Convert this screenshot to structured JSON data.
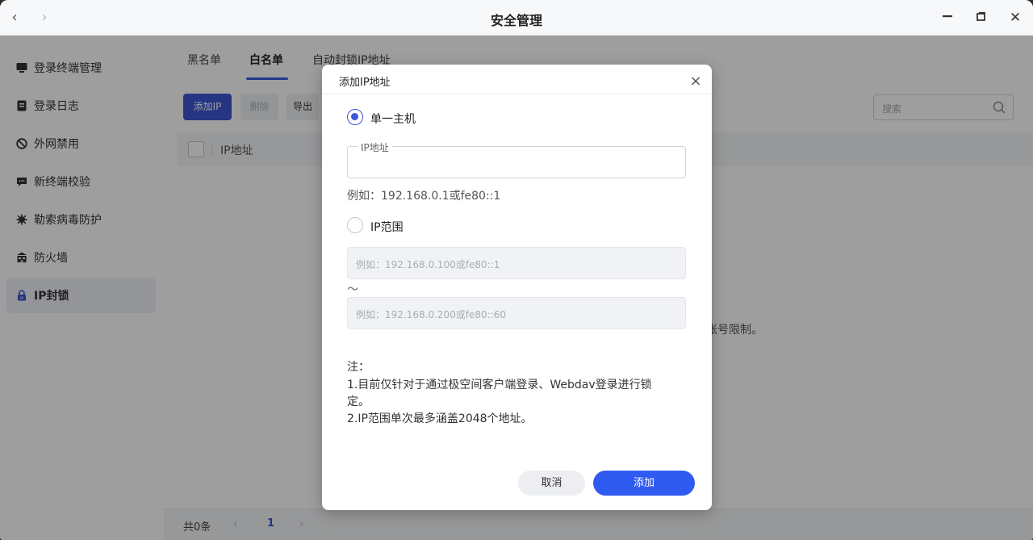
{
  "window": {
    "title": "安全管理",
    "back": "‹",
    "forward": "›",
    "minimize": "—",
    "restore": "▫",
    "close": "✕"
  },
  "sidebar": {
    "items": [
      {
        "label": "登录终端管理",
        "icon": "monitor-icon"
      },
      {
        "label": "登录日志",
        "icon": "log-icon"
      },
      {
        "label": "外网禁用",
        "icon": "ban-icon"
      },
      {
        "label": "新终端校验",
        "icon": "chat-icon"
      },
      {
        "label": "勒索病毒防护",
        "icon": "virus-icon"
      },
      {
        "label": "防火墙",
        "icon": "firewall-icon"
      },
      {
        "label": "IP封锁",
        "icon": "lock-icon",
        "active": true
      }
    ]
  },
  "main": {
    "tabs": [
      "黑名单",
      "白名单",
      "自动封锁IP地址"
    ],
    "active_tab": "白名单",
    "toolbar": {
      "add": "添加IP",
      "delete": "删除",
      "export": "导出"
    },
    "search_placeholder": "搜索",
    "table_header": "IP地址",
    "empty_hint_fragment": "账号限制。",
    "footer": {
      "total": "共0条",
      "prev": "‹",
      "page": "1",
      "next": "›"
    }
  },
  "dialog": {
    "title": "添加IP地址",
    "close": "×",
    "single_host_label": "单一主机",
    "ip_field_legend": "IP地址",
    "single_hint": "例如：192.168.0.1或fe80::1",
    "range_label": "IP范围",
    "range_start_placeholder": "例如：192.168.0.100或fe80::1",
    "range_sep": "～",
    "range_end_placeholder": "例如：192.168.0.200或fe80::60",
    "note_title": "注：",
    "note_line1": "1.目前仅针对于通过极空间客户端登录、Webdav登录进行锁",
    "note_line1b": "定。",
    "note_line2": "2.IP范围单次最多涵盖2048个地址。",
    "cancel": "取消",
    "confirm": "添加"
  },
  "colors": {
    "accent": "#3d56d6",
    "confirm": "#2f5bf0"
  }
}
